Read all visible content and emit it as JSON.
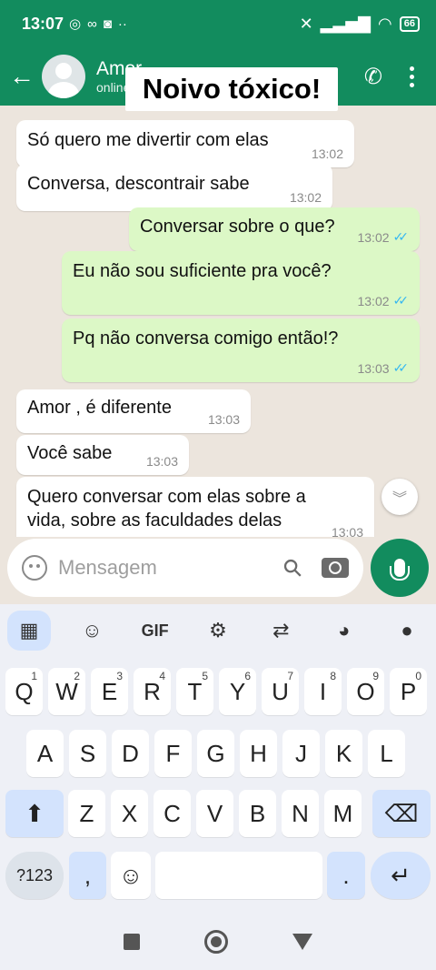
{
  "status_bar": {
    "time": "13:07",
    "battery": "66"
  },
  "header": {
    "contact_name": "Amor",
    "contact_status": "online"
  },
  "overlay_caption": "Noivo tóxico!",
  "messages": [
    {
      "dir": "in",
      "text": "Só quero me divertir com elas",
      "time": "13:02"
    },
    {
      "dir": "in",
      "text": "Conversa, descontrair sabe",
      "time": "13:02"
    },
    {
      "dir": "out",
      "text": "Conversar sobre o que?",
      "time": "13:02"
    },
    {
      "dir": "out",
      "text": "Eu não sou suficiente pra você?",
      "time": "13:02"
    },
    {
      "dir": "out",
      "text": "Pq não conversa comigo então!?",
      "time": "13:03"
    },
    {
      "dir": "in",
      "text": "Amor , é diferente",
      "time": "13:03"
    },
    {
      "dir": "in",
      "text": "Você sabe",
      "time": "13:03"
    },
    {
      "dir": "in",
      "text": "Quero conversar com elas sobre a vida, sobre as faculdades delas",
      "time": "13:03"
    }
  ],
  "input": {
    "placeholder": "Mensagem"
  },
  "keyboard": {
    "toolbar": {
      "gif": "GIF"
    },
    "row1": [
      {
        "k": "Q",
        "h": "1"
      },
      {
        "k": "W",
        "h": "2"
      },
      {
        "k": "E",
        "h": "3"
      },
      {
        "k": "R",
        "h": "4"
      },
      {
        "k": "T",
        "h": "5"
      },
      {
        "k": "Y",
        "h": "6"
      },
      {
        "k": "U",
        "h": "7"
      },
      {
        "k": "I",
        "h": "8"
      },
      {
        "k": "O",
        "h": "9"
      },
      {
        "k": "P",
        "h": "0"
      }
    ],
    "row2": [
      "A",
      "S",
      "D",
      "F",
      "G",
      "H",
      "J",
      "K",
      "L"
    ],
    "row3": [
      "Z",
      "X",
      "C",
      "V",
      "B",
      "N",
      "M"
    ],
    "symbols": "?123",
    "comma": ",",
    "period": "."
  }
}
